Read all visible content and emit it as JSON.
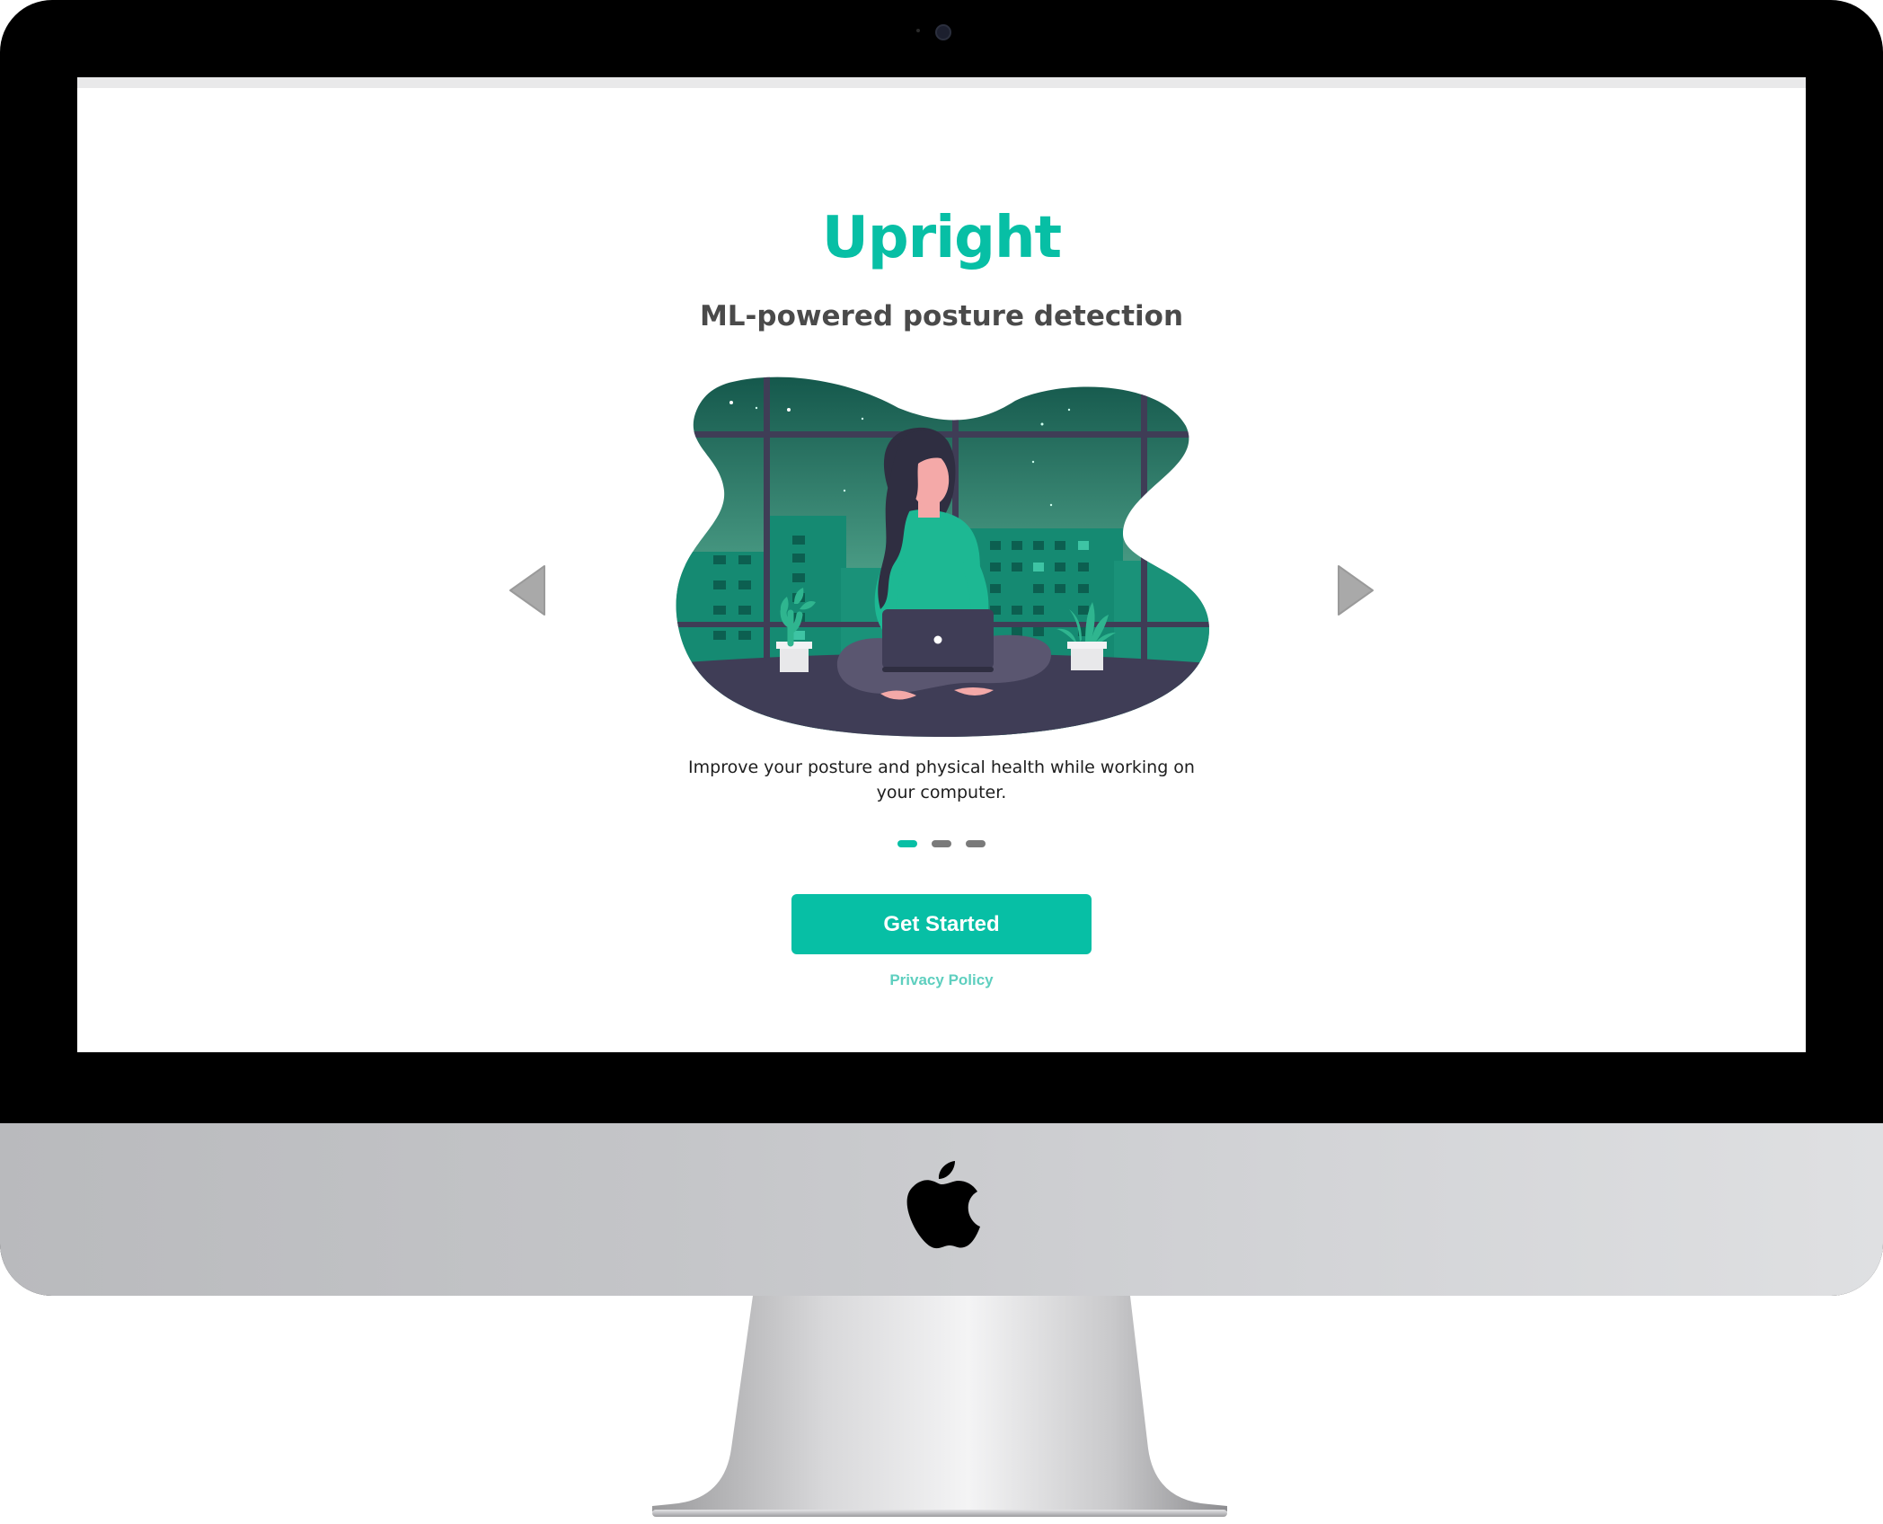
{
  "app": {
    "title": "Upright",
    "subtitle": "ML-powered posture detection"
  },
  "carousel": {
    "caption": "Improve your posture and physical health while working on your computer.",
    "slide_count": 3,
    "active_index": 0,
    "prev_icon": "triangle-left-icon",
    "next_icon": "triangle-right-icon"
  },
  "actions": {
    "get_started_label": "Get Started",
    "privacy_label": "Privacy Policy"
  },
  "colors": {
    "accent": "#07bfa5",
    "subtitle": "#4a4a4a",
    "dot_inactive": "#7a7a7a",
    "illustration_sky": "#1d7a66",
    "illustration_floor": "#3f3d56"
  },
  "device": {
    "logo_icon": "apple-logo-icon"
  }
}
